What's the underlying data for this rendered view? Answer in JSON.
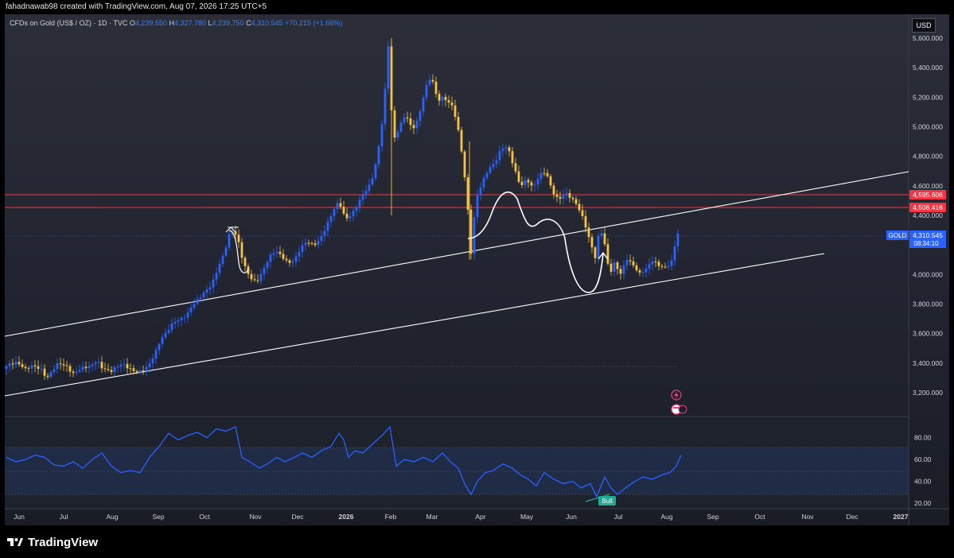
{
  "header": {
    "text": "fahadnawab98 created with TradingView.com, Aug 07, 2026 17:25 UTC+5"
  },
  "legend": {
    "symbol": "CFDs on Gold (US$ / OZ) · 1D · TVC",
    "o_label": "O",
    "o_value": "4,239.550",
    "h_label": "H",
    "h_value": "4,327.780",
    "l_label": "L",
    "l_value": "4,239.750",
    "c_label": "C",
    "c_value": "4,310.545",
    "change": "+70.215 (+1.66%)"
  },
  "currency": "USD",
  "brand": {
    "name": "TradingView"
  },
  "colors": {
    "up": "#2962ff",
    "down": "#f6c343",
    "rsi_line": "#2962ff",
    "resistance": "#f23645",
    "trend_line": "#ffffff",
    "price_badge": "#2962ff"
  },
  "chart_data": {
    "type": "candlestick",
    "y_axis": {
      "range": [
        3050,
        5750
      ],
      "ticks": [
        "5,600.000",
        "5,400.000",
        "5,200.000",
        "5,000.000",
        "4,800.000",
        "4,600.000",
        "4,400.000",
        "4,200.000",
        "4,000.000",
        "3,800.000",
        "3,600.000",
        "3,400.000",
        "3,200.000"
      ]
    },
    "x_axis": {
      "ticks": [
        "Jun",
        "Jul",
        "Aug",
        "Sep",
        "Oct",
        "Nov",
        "Dec",
        "2026",
        "Feb",
        "Mar",
        "Apr",
        "May",
        "Jun",
        "Jul",
        "Aug",
        "Sep",
        "Oct",
        "Nov",
        "Dec",
        "2027"
      ]
    },
    "price_path": [
      [
        0,
        3360
      ],
      [
        8,
        3390
      ],
      [
        18,
        3410
      ],
      [
        28,
        3360
      ],
      [
        38,
        3380
      ],
      [
        48,
        3360
      ],
      [
        55,
        3300
      ],
      [
        62,
        3350
      ],
      [
        70,
        3400
      ],
      [
        80,
        3380
      ],
      [
        88,
        3330
      ],
      [
        98,
        3360
      ],
      [
        108,
        3380
      ],
      [
        118,
        3420
      ],
      [
        125,
        3360
      ],
      [
        135,
        3340
      ],
      [
        142,
        3380
      ],
      [
        150,
        3400
      ],
      [
        158,
        3360
      ],
      [
        166,
        3340
      ],
      [
        174,
        3350
      ],
      [
        182,
        3380
      ],
      [
        190,
        3450
      ],
      [
        198,
        3560
      ],
      [
        206,
        3620
      ],
      [
        214,
        3680
      ],
      [
        222,
        3690
      ],
      [
        230,
        3720
      ],
      [
        238,
        3800
      ],
      [
        246,
        3840
      ],
      [
        254,
        3880
      ],
      [
        262,
        3930
      ],
      [
        270,
        4050
      ],
      [
        278,
        4150
      ],
      [
        286,
        4300
      ],
      [
        294,
        4260
      ],
      [
        302,
        4080
      ],
      [
        310,
        3980
      ],
      [
        318,
        3940
      ],
      [
        326,
        4020
      ],
      [
        334,
        4120
      ],
      [
        342,
        4160
      ],
      [
        350,
        4120
      ],
      [
        358,
        4080
      ],
      [
        366,
        4100
      ],
      [
        374,
        4180
      ],
      [
        382,
        4220
      ],
      [
        390,
        4200
      ],
      [
        398,
        4240
      ],
      [
        406,
        4320
      ],
      [
        414,
        4420
      ],
      [
        422,
        4500
      ],
      [
        430,
        4380
      ],
      [
        438,
        4400
      ],
      [
        446,
        4480
      ],
      [
        454,
        4560
      ],
      [
        462,
        4620
      ],
      [
        470,
        4780
      ],
      [
        478,
        5100
      ],
      [
        484,
        5550
      ],
      [
        490,
        4900
      ],
      [
        498,
        5000
      ],
      [
        506,
        5080
      ],
      [
        514,
        4980
      ],
      [
        522,
        5060
      ],
      [
        530,
        5250
      ],
      [
        538,
        5340
      ],
      [
        546,
        5180
      ],
      [
        552,
        5200
      ],
      [
        558,
        5180
      ],
      [
        566,
        5120
      ],
      [
        574,
        4920
      ],
      [
        582,
        4580
      ],
      [
        588,
        4150
      ],
      [
        594,
        4500
      ],
      [
        602,
        4620
      ],
      [
        610,
        4720
      ],
      [
        618,
        4760
      ],
      [
        626,
        4850
      ],
      [
        634,
        4860
      ],
      [
        642,
        4730
      ],
      [
        650,
        4600
      ],
      [
        658,
        4640
      ],
      [
        666,
        4580
      ],
      [
        674,
        4680
      ],
      [
        682,
        4700
      ],
      [
        690,
        4560
      ],
      [
        698,
        4500
      ],
      [
        706,
        4560
      ],
      [
        714,
        4520
      ],
      [
        722,
        4460
      ],
      [
        730,
        4360
      ],
      [
        738,
        4220
      ],
      [
        744,
        4120
      ],
      [
        750,
        4320
      ],
      [
        756,
        4200
      ],
      [
        762,
        4000
      ],
      [
        768,
        4080
      ],
      [
        776,
        4010
      ],
      [
        784,
        4100
      ],
      [
        792,
        4060
      ],
      [
        800,
        4010
      ],
      [
        808,
        4040
      ],
      [
        816,
        4090
      ],
      [
        824,
        4060
      ],
      [
        832,
        4050
      ],
      [
        840,
        4090
      ],
      [
        846,
        4240
      ],
      [
        850,
        4310
      ]
    ],
    "rsi": {
      "levels": [
        "80.00",
        "60.00",
        "40.00",
        "20.00"
      ],
      "range": [
        15,
        95
      ],
      "path": [
        [
          0,
          62
        ],
        [
          12,
          58
        ],
        [
          24,
          60
        ],
        [
          36,
          64
        ],
        [
          48,
          62
        ],
        [
          60,
          55
        ],
        [
          72,
          54
        ],
        [
          84,
          58
        ],
        [
          96,
          52
        ],
        [
          108,
          60
        ],
        [
          120,
          66
        ],
        [
          132,
          54
        ],
        [
          144,
          48
        ],
        [
          156,
          50
        ],
        [
          168,
          48
        ],
        [
          180,
          62
        ],
        [
          192,
          72
        ],
        [
          204,
          84
        ],
        [
          216,
          78
        ],
        [
          228,
          82
        ],
        [
          240,
          85
        ],
        [
          252,
          80
        ],
        [
          264,
          88
        ],
        [
          276,
          86
        ],
        [
          288,
          90
        ],
        [
          296,
          62
        ],
        [
          306,
          58
        ],
        [
          318,
          52
        ],
        [
          328,
          56
        ],
        [
          340,
          62
        ],
        [
          350,
          58
        ],
        [
          362,
          62
        ],
        [
          372,
          66
        ],
        [
          384,
          62
        ],
        [
          396,
          68
        ],
        [
          408,
          72
        ],
        [
          418,
          84
        ],
        [
          424,
          78
        ],
        [
          430,
          62
        ],
        [
          438,
          68
        ],
        [
          448,
          66
        ],
        [
          460,
          74
        ],
        [
          472,
          82
        ],
        [
          482,
          90
        ],
        [
          490,
          54
        ],
        [
          500,
          60
        ],
        [
          512,
          58
        ],
        [
          524,
          62
        ],
        [
          536,
          58
        ],
        [
          548,
          66
        ],
        [
          558,
          58
        ],
        [
          568,
          52
        ],
        [
          576,
          38
        ],
        [
          584,
          28
        ],
        [
          592,
          40
        ],
        [
          602,
          48
        ],
        [
          612,
          50
        ],
        [
          624,
          56
        ],
        [
          636,
          52
        ],
        [
          646,
          46
        ],
        [
          656,
          42
        ],
        [
          666,
          36
        ],
        [
          676,
          48
        ],
        [
          688,
          42
        ],
        [
          700,
          38
        ],
        [
          712,
          40
        ],
        [
          722,
          34
        ],
        [
          734,
          38
        ],
        [
          742,
          26
        ],
        [
          752,
          44
        ],
        [
          760,
          34
        ],
        [
          768,
          28
        ],
        [
          778,
          34
        ],
        [
          790,
          40
        ],
        [
          800,
          44
        ],
        [
          812,
          42
        ],
        [
          824,
          46
        ],
        [
          834,
          48
        ],
        [
          842,
          54
        ],
        [
          848,
          64
        ]
      ],
      "label": "Bull"
    },
    "markers": {
      "gold_label": "GOLD",
      "last_price": "4,310.545",
      "countdown": "08:34:10",
      "resistance_1": "4,595.606",
      "resistance_2": "4,506.416"
    }
  }
}
